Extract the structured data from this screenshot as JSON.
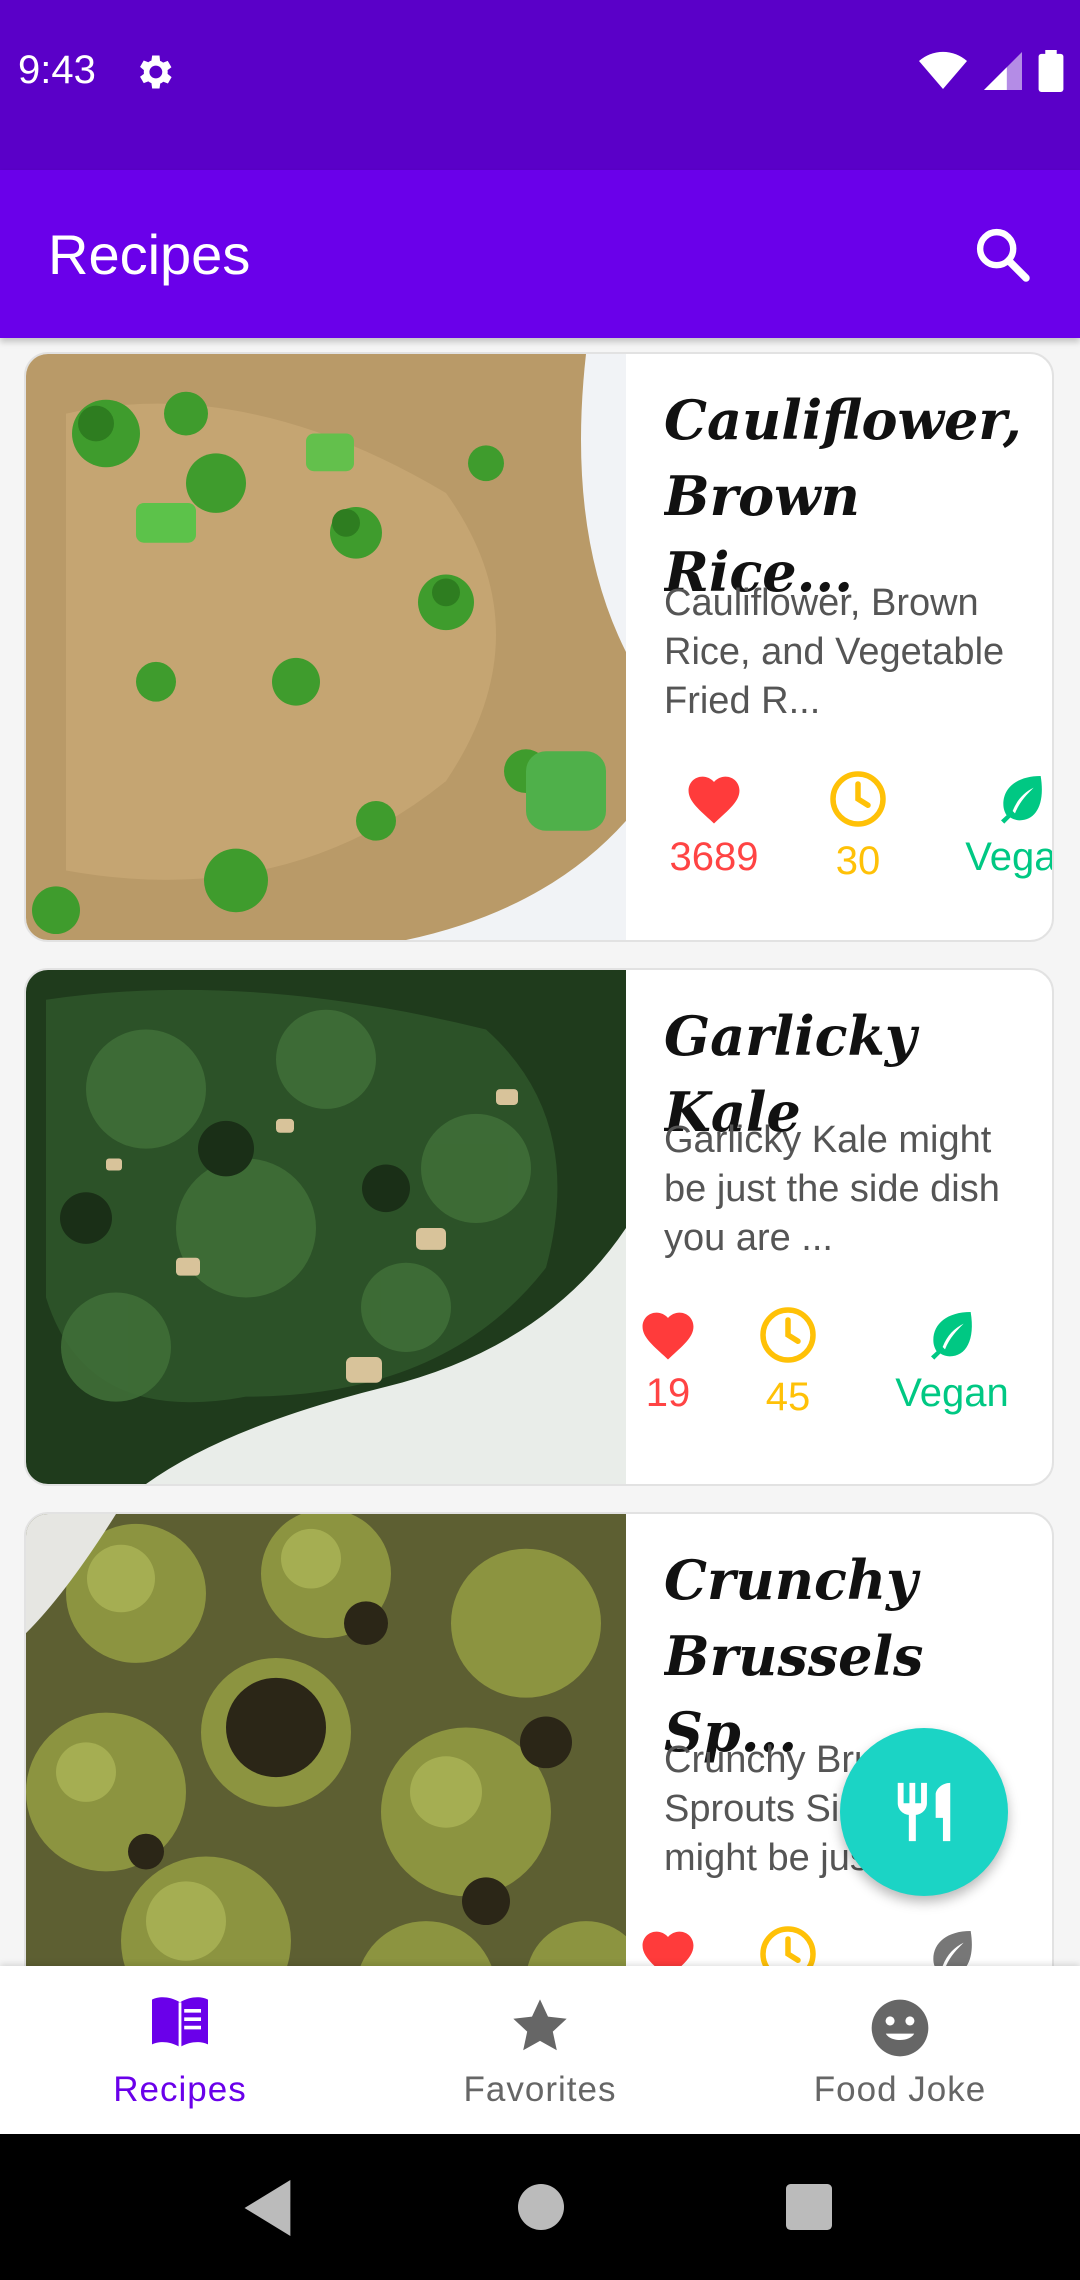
{
  "status_bar": {
    "time": "9:43"
  },
  "app_bar": {
    "title": "Recipes"
  },
  "colors": {
    "primary": "#6a00ea",
    "status": "#5a00c8",
    "likes": "#ff4444",
    "time": "#ffc107",
    "vegan": "#00c883",
    "fab": "#1bd4c5"
  },
  "recipes": [
    {
      "title": "Cauliflower, Brown Rice...",
      "description": "Cauliflower, Brown Rice, and Vegetable Fried R...",
      "likes": "3689",
      "minutes": "30",
      "tag": "Vegan"
    },
    {
      "title": "Garlicky Kale",
      "description": "Garlicky Kale might be just the side dish you are ...",
      "likes": "19",
      "minutes": "45",
      "tag": "Vegan"
    },
    {
      "title": "Crunchy Brussels Sp...",
      "description": "Crunchy Brussels Sprouts Side Dish might be just...",
      "likes": "",
      "minutes": "",
      "tag": ""
    }
  ],
  "bottom_nav": {
    "items": [
      {
        "label": "Recipes",
        "icon": "menu-book-icon",
        "active": true
      },
      {
        "label": "Favorites",
        "icon": "star-icon",
        "active": false
      },
      {
        "label": "Food Joke",
        "icon": "smiley-icon",
        "active": false
      }
    ]
  },
  "fab": {
    "icon": "restaurant-icon"
  }
}
